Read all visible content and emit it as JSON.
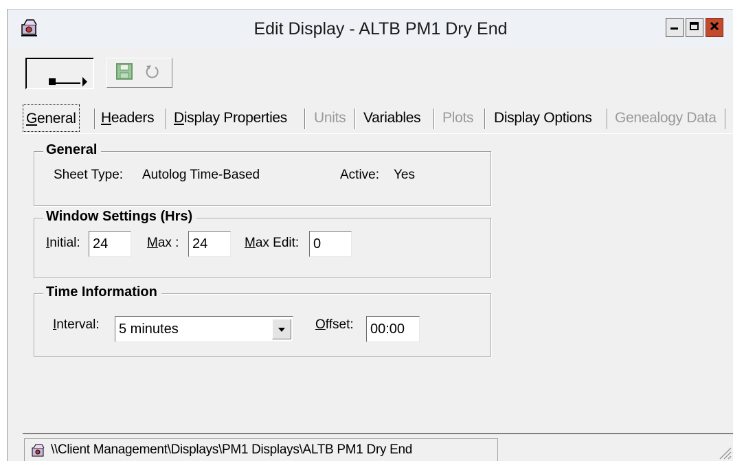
{
  "window": {
    "title": "Edit Display - ALTB PM1 Dry End",
    "icon": "app-editor-icon",
    "controls": [
      "minimize-icon",
      "maximize-icon",
      "close-icon"
    ]
  },
  "toolbar": {
    "nav_icon": "step-forward-icon",
    "save_icon": "save-icon",
    "undo_icon": "undo-icon"
  },
  "tabs": [
    {
      "label": "General",
      "underline": "G",
      "rest": "eneral",
      "state": "active"
    },
    {
      "label": "Headers",
      "underline": "H",
      "rest": "eaders",
      "state": "enabled"
    },
    {
      "label": "Display Properties",
      "underline": "D",
      "rest": "isplay Properties",
      "state": "enabled"
    },
    {
      "label": "Units",
      "state": "disabled"
    },
    {
      "label": "Variables",
      "state": "enabled"
    },
    {
      "label": "Plots",
      "state": "disabled"
    },
    {
      "label": "Display Options",
      "state": "enabled"
    },
    {
      "label": "Genealogy Data",
      "state": "disabled"
    }
  ],
  "general": {
    "legend": "General",
    "sheet_type_label": "Sheet Type:",
    "sheet_type_value": "Autolog Time-Based",
    "active_label": "Active:",
    "active_value": "Yes"
  },
  "window_settings": {
    "legend": "Window Settings (Hrs)",
    "initial_label_u": "I",
    "initial_label_rest": "nitial:",
    "initial_value": "24",
    "max_label_u": "M",
    "max_label_rest": "ax :",
    "max_value": "24",
    "max_edit_label_u": "M",
    "max_edit_label_rest": "ax Edit:",
    "max_edit_value": "0"
  },
  "time_information": {
    "legend": "Time Information",
    "interval_label_pre": "",
    "interval_label_u": "I",
    "interval_label_rest": "nterval:",
    "interval_value": "5 minutes",
    "offset_label_u": "O",
    "offset_label_rest": "ffset:",
    "offset_value": "00:00"
  },
  "status": {
    "path": "\\\\Client Management\\Displays\\PM1 Displays\\ALTB PM1 Dry End",
    "icon": "display-path-icon",
    "grip_icon": "resize-grip-icon"
  }
}
